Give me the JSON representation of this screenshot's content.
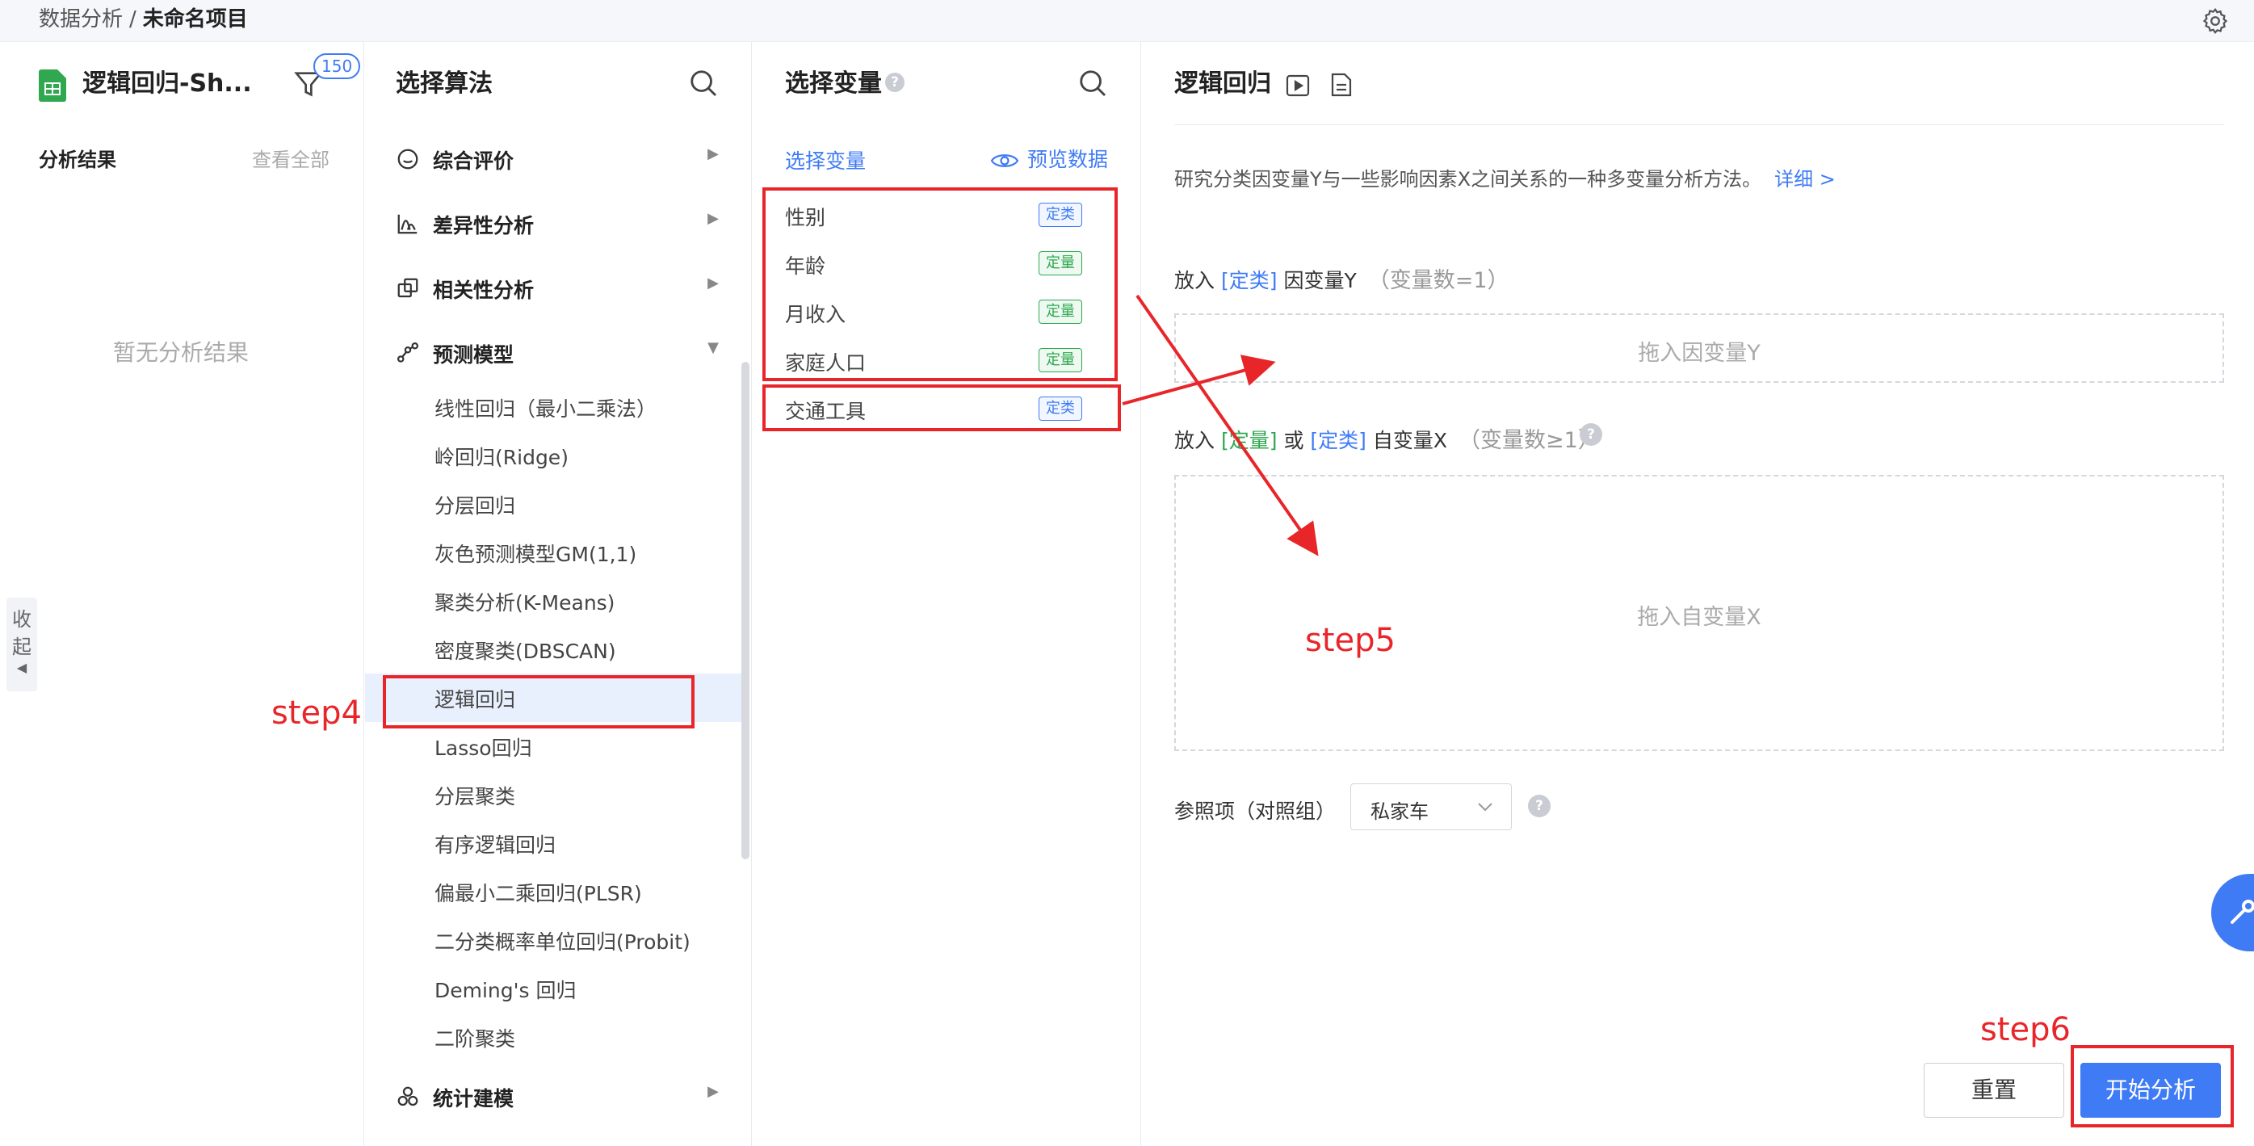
{
  "breadcrumb": {
    "parent": "数据分析",
    "separator": "/",
    "current": "未命名项目"
  },
  "file": {
    "name": "逻辑回归-Sh...",
    "filter_count": "150"
  },
  "results": {
    "title": "分析结果",
    "view_all": "查看全部",
    "empty": "暂无分析结果"
  },
  "collapse": {
    "label_1": "收",
    "label_2": "起"
  },
  "algorithms": {
    "title": "选择算法",
    "categories": [
      {
        "label": "综合评价"
      },
      {
        "label": "差异性分析"
      },
      {
        "label": "相关性分析"
      },
      {
        "label": "预测模型"
      },
      {
        "label": "统计建模"
      }
    ],
    "predict_items": [
      "线性回归（最小二乘法）",
      "岭回归(Ridge)",
      "分层回归",
      "灰色预测模型GM(1,1)",
      "聚类分析(K-Means)",
      "密度聚类(DBSCAN)",
      "逻辑回归",
      "Lasso回归",
      "分层聚类",
      "有序逻辑回归",
      "偏最小二乘回归(PLSR)",
      "二分类概率单位回归(Probit)",
      "Deming's 回归",
      "二阶聚类"
    ],
    "selected": "逻辑回归"
  },
  "variables": {
    "title": "选择变量",
    "help": "?",
    "subtitle": "选择变量",
    "preview": "预览数据",
    "items": [
      {
        "name": "性别",
        "type": "定类"
      },
      {
        "name": "年龄",
        "type": "定量"
      },
      {
        "name": "月收入",
        "type": "定量"
      },
      {
        "name": "家庭人口",
        "type": "定量"
      },
      {
        "name": "交通工具",
        "type": "定类"
      }
    ]
  },
  "method": {
    "title": "逻辑回归",
    "description": "研究分类因变量Y与一些影响因素X之间关系的一种多变量分析方法。",
    "detail_link": "详细 >",
    "y_zone": {
      "prefix": "放入",
      "type_tag": "[定类]",
      "label": "因变量Y",
      "count": "（变量数=1）",
      "placeholder": "拖入因变量Y"
    },
    "x_zone": {
      "prefix": "放入",
      "type_tag_1": "[定量]",
      "or": "或",
      "type_tag_2": "[定类]",
      "label": "自变量X",
      "count": "（变量数≥1）",
      "placeholder": "拖入自变量X"
    },
    "reference": {
      "label": "参照项（对照组）",
      "value": "私家车"
    },
    "help": "?",
    "reset_button": "重置",
    "start_button": "开始分析"
  },
  "annotations": {
    "step4": "step4",
    "step5": "step5",
    "step6": "step6"
  },
  "colors": {
    "accent": "#3f7bf5",
    "annotation": "#e8262a",
    "qualitative_tag": "#3f7bf5",
    "quantitative_tag": "#2fa84f"
  }
}
